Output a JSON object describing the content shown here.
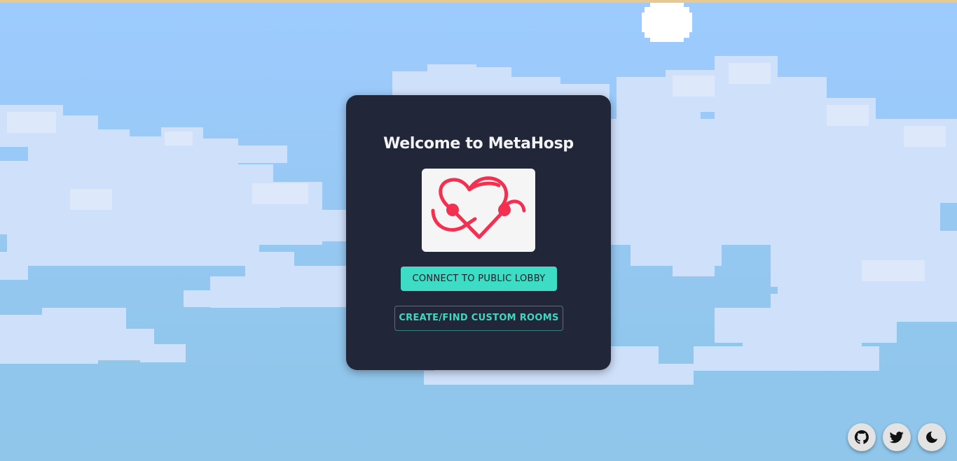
{
  "welcome": {
    "title": "Welcome to MetaHosp"
  },
  "logo": {
    "icon": "heart-stethoscope-logo-icon",
    "color": "#f3304f"
  },
  "actions": {
    "connect_public_lobby": "CONNECT TO PUBLIC LOBBY",
    "create_find_custom_rooms": "CREATE/FIND CUSTOM ROOMS"
  },
  "corner_buttons": [
    {
      "icon": "github-icon"
    },
    {
      "icon": "twitter-icon"
    },
    {
      "icon": "moon-icon"
    }
  ],
  "colors": {
    "panel": "#222639",
    "accent": "#3ddcc4",
    "sky": "#99c9f6",
    "cloud": "#c9defa"
  }
}
